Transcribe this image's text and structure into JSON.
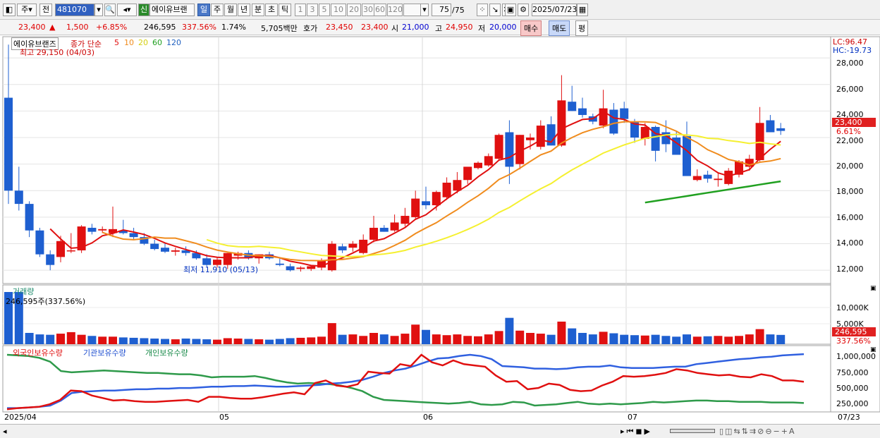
{
  "toolbar": {
    "market": "주",
    "prev": "전",
    "code": "481070",
    "stock_name": "에이유브랜",
    "tag_new": "신",
    "periods": [
      "일",
      "주",
      "월",
      "년",
      "분",
      "초",
      "틱"
    ],
    "nums": [
      "1",
      "3",
      "5",
      "10",
      "20",
      "30",
      "60",
      "120"
    ],
    "count": "75",
    "count_total": "/75",
    "date": "2025/07/23"
  },
  "info": {
    "price": "23,400",
    "change": "1,500",
    "change_pct": "+6.85%",
    "volume": "246,595",
    "vol_ratio": "337.56%",
    "turnover": "1.74%",
    "amount": "5,705백만",
    "hoga_label": "호가",
    "hoga1": "23,450",
    "hoga2": "23,400",
    "open_label": "시",
    "open": "21,000",
    "high_label": "고",
    "high": "24,950",
    "low_label": "저",
    "low": "20,000",
    "buy": "매수",
    "sell": "매도",
    "avg": "평"
  },
  "price_pane": {
    "legend_name": "에이유브랜즈",
    "legend_ma": "종가 단순",
    "ma_periods": [
      "5",
      "10",
      "20",
      "60",
      "120"
    ],
    "max_label": "최고 29,150 (04/03)",
    "min_label": "최저 11,910 (05/13)",
    "lc": "LC:96.47",
    "hc": "HC:-19.73",
    "y_ticks": [
      "28,000",
      "26,000",
      "24,000",
      "22,000",
      "20,000",
      "18,000",
      "16,000",
      "14,000",
      "12,000"
    ],
    "price_tag": "23,400",
    "pct_tag": "6.61%"
  },
  "volume_pane": {
    "title": "거래량",
    "value": "246,595주(337.56%)",
    "y_ticks": [
      "10,000K",
      "5,000K"
    ],
    "tag": "246,595",
    "tag_pct": "337.56%"
  },
  "holding_pane": {
    "series": [
      "외국인보유수량",
      "기관보유수량",
      "개인보유수량"
    ],
    "y_ticks": [
      "1,000,000",
      "750,000",
      "500,000",
      "250,000"
    ]
  },
  "x_labels": [
    "2025/04",
    "05",
    "06",
    "07",
    "07/23"
  ],
  "colors": {
    "up": "#e01010",
    "down": "#1e5fd0",
    "ma5": "#e01010",
    "ma10": "#f08c1e",
    "ma20": "#f5f030",
    "ma60": "#20a020"
  },
  "chart_data": {
    "type": "candlestick",
    "dates_note": "daily 2025/04/02 to 2025/07/23",
    "candles": [
      [
        25000,
        29000,
        17000,
        18000
      ],
      [
        18000,
        19800,
        16500,
        17000
      ],
      [
        17000,
        17200,
        14500,
        15000
      ],
      [
        15000,
        15200,
        13000,
        13200
      ],
      [
        13200,
        13500,
        12000,
        12400
      ],
      [
        13000,
        14600,
        12600,
        14200
      ],
      [
        13500,
        14800,
        13300,
        13500
      ],
      [
        13500,
        15400,
        13300,
        15300
      ],
      [
        15200,
        15500,
        14700,
        14900
      ],
      [
        15000,
        15300,
        14800,
        15100
      ],
      [
        14800,
        16800,
        14500,
        15100
      ],
      [
        15000,
        15800,
        14700,
        14800
      ],
      [
        14800,
        15200,
        14300,
        14500
      ],
      [
        14500,
        14800,
        13900,
        14000
      ],
      [
        14000,
        14300,
        13500,
        13600
      ],
      [
        13700,
        14000,
        13300,
        13400
      ],
      [
        13400,
        13700,
        13100,
        13500
      ],
      [
        13500,
        13800,
        13100,
        13300
      ],
      [
        13300,
        13500,
        12800,
        12900
      ],
      [
        12900,
        13200,
        12300,
        12400
      ],
      [
        12400,
        13000,
        12200,
        12800
      ],
      [
        12400,
        13300,
        12100,
        13300
      ],
      [
        13100,
        13400,
        12800,
        13300
      ],
      [
        13300,
        13500,
        12800,
        12900
      ],
      [
        12900,
        13200,
        12500,
        13200
      ],
      [
        13200,
        13400,
        12800,
        12900
      ],
      [
        12500,
        12900,
        12300,
        12400
      ],
      [
        12300,
        12500,
        11910,
        12000
      ],
      [
        12100,
        12300,
        11900,
        12200
      ],
      [
        12100,
        12400,
        11950,
        12300
      ],
      [
        12200,
        12900,
        12000,
        12700
      ],
      [
        12000,
        14200,
        11900,
        14000
      ],
      [
        13800,
        14000,
        13300,
        13500
      ],
      [
        13700,
        14200,
        13400,
        14000
      ],
      [
        13300,
        14700,
        13200,
        14300
      ],
      [
        14300,
        16100,
        14100,
        15200
      ],
      [
        15200,
        15400,
        14900,
        14900
      ],
      [
        15000,
        16200,
        14900,
        15600
      ],
      [
        15500,
        16700,
        15300,
        16100
      ],
      [
        16000,
        18000,
        15900,
        17400
      ],
      [
        17200,
        18300,
        16600,
        16900
      ],
      [
        16900,
        18000,
        16500,
        17900
      ],
      [
        17500,
        19000,
        17300,
        18600
      ],
      [
        18000,
        19400,
        17800,
        18800
      ],
      [
        18800,
        19700,
        18500,
        19800
      ],
      [
        19700,
        20200,
        19600,
        20100
      ],
      [
        19900,
        20800,
        19800,
        20600
      ],
      [
        20400,
        22300,
        20300,
        22200
      ],
      [
        22400,
        23300,
        18500,
        19800
      ],
      [
        20000,
        22200,
        19600,
        22200
      ],
      [
        21800,
        22300,
        21100,
        22000
      ],
      [
        21300,
        23300,
        21100,
        22900
      ],
      [
        23000,
        23600,
        21400,
        21400
      ],
      [
        21400,
        26700,
        21300,
        24800
      ],
      [
        24700,
        25900,
        24000,
        24000
      ],
      [
        24200,
        25000,
        23500,
        23700
      ],
      [
        23600,
        23800,
        23000,
        23200
      ],
      [
        22900,
        25600,
        22700,
        24200
      ],
      [
        24100,
        24600,
        22200,
        22300
      ],
      [
        24200,
        24700,
        23100,
        23400
      ],
      [
        23200,
        23400,
        21600,
        22000
      ],
      [
        21900,
        23100,
        21400,
        22800
      ],
      [
        22800,
        22900,
        20200,
        21000
      ],
      [
        22400,
        23300,
        20900,
        21500
      ],
      [
        22000,
        22500,
        20800,
        20700
      ],
      [
        22100,
        23200,
        19900,
        19100
      ],
      [
        18800,
        19600,
        18700,
        19100
      ],
      [
        19200,
        19500,
        18600,
        18900
      ],
      [
        18800,
        19300,
        18300,
        18900
      ],
      [
        18500,
        19700,
        18400,
        19500
      ],
      [
        19200,
        20300,
        19000,
        20200
      ],
      [
        19800,
        20700,
        19500,
        20400
      ],
      [
        20300,
        24300,
        20200,
        23100
      ],
      [
        23300,
        23700,
        22400,
        22400
      ],
      [
        22700,
        23100,
        22200,
        22500
      ]
    ]
  }
}
